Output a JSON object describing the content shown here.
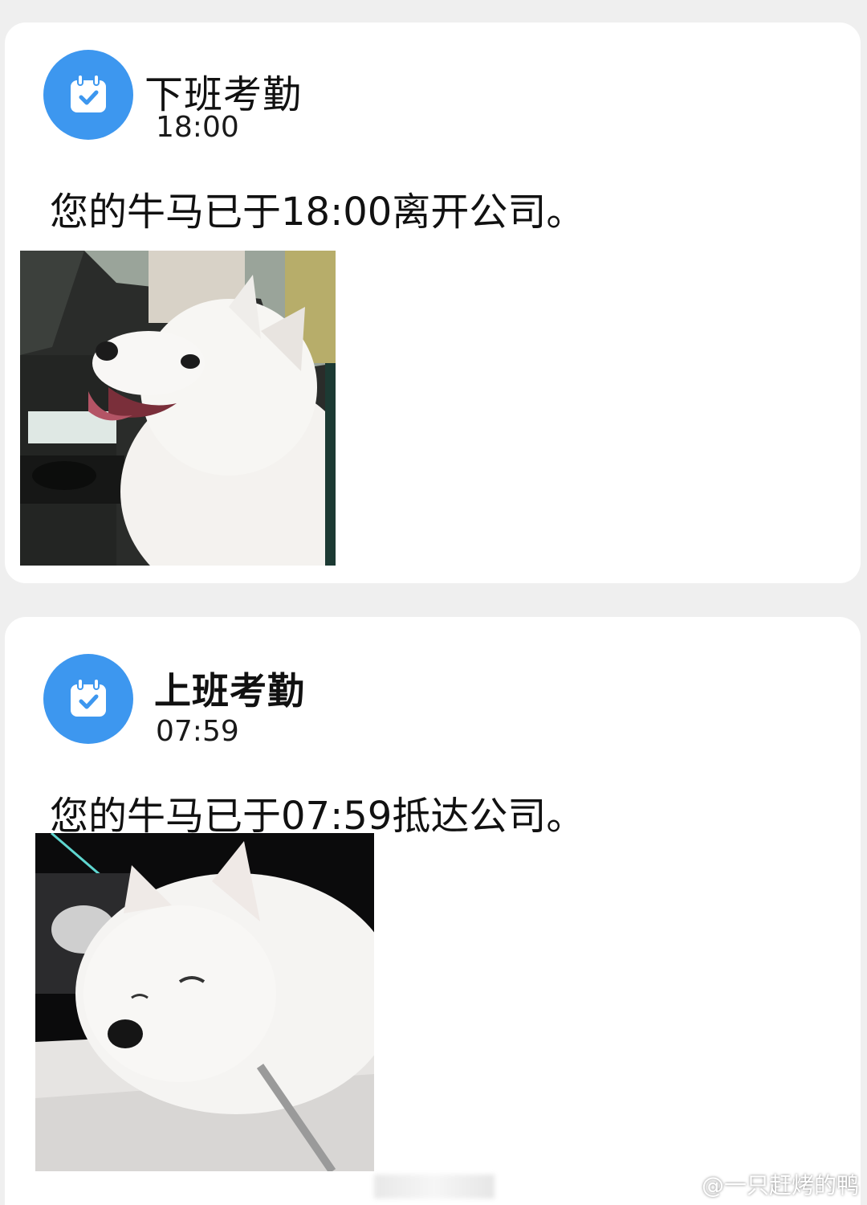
{
  "notifications": [
    {
      "icon": "calendar-check-icon",
      "title": "下班考勤",
      "time": "18:00",
      "message": "您的牛马已于18:00离开公司。",
      "photo": "dog-smiling-in-car-photo"
    },
    {
      "icon": "calendar-check-icon",
      "title": "上班考勤",
      "time": "07:59",
      "message": "您的牛马已于07:59抵达公司。",
      "photo": "dog-sleeping-in-car-photo"
    }
  ],
  "watermark": {
    "icon": "weibo-logo-icon",
    "text": "@一只赶烤的鸭"
  },
  "colors": {
    "icon_bg": "#3d97ef",
    "page_bg": "#efefef",
    "card_bg": "#ffffff"
  }
}
